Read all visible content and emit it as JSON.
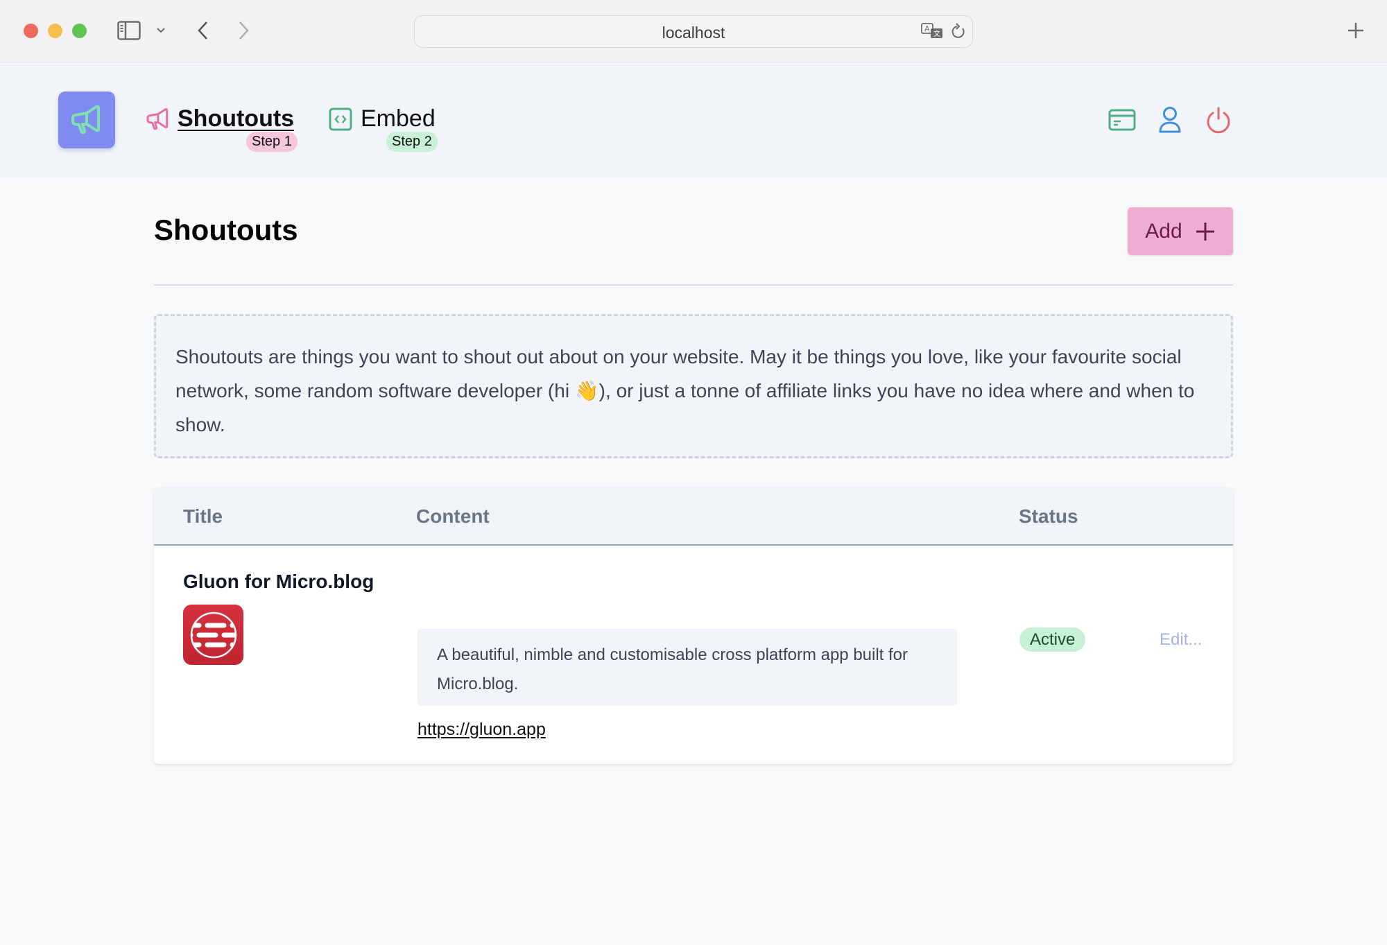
{
  "browser": {
    "address": "localhost",
    "buttons": {
      "sidebar": "sidebar-toggle",
      "back": "back",
      "forward": "forward",
      "translate": "translate",
      "reload": "reload",
      "new_tab": "new-tab"
    }
  },
  "header": {
    "nav": [
      {
        "label": "Shoutouts",
        "step": "Step 1",
        "active": true,
        "icon": "megaphone-icon",
        "step_color": "#f6c6de",
        "icon_color": "#e46fa8"
      },
      {
        "label": "Embed",
        "step": "Step 2",
        "active": false,
        "icon": "code-icon",
        "step_color": "#c9f1d6",
        "icon_color": "#4fae82"
      }
    ],
    "actions": [
      {
        "name": "billing",
        "icon": "credit-card-icon",
        "color": "#4fae82"
      },
      {
        "name": "account",
        "icon": "user-icon",
        "color": "#3f8fdc"
      },
      {
        "name": "logout",
        "icon": "power-icon",
        "color": "#e06a6a"
      }
    ],
    "logo_color": "#7f8bef",
    "logo_icon_color": "#7ee0b3"
  },
  "page": {
    "title": "Shoutouts",
    "add_label": "Add",
    "add_color": "#eeaed3",
    "description": "Shoutouts are things you want to shout out about on your website. May it be things you love, like your favourite social network, some random software developer (hi 👋), or just a tonne of affiliate links you have no idea where and when to show."
  },
  "table": {
    "columns": [
      "Title",
      "Content",
      "Status"
    ],
    "rows": [
      {
        "title": "Gluon for Micro.blog",
        "content": "A beautiful, nimble and customisable cross platform app built for Micro.blog.",
        "link": "https://gluon.app",
        "status": "Active",
        "action": "Edit..."
      }
    ]
  }
}
